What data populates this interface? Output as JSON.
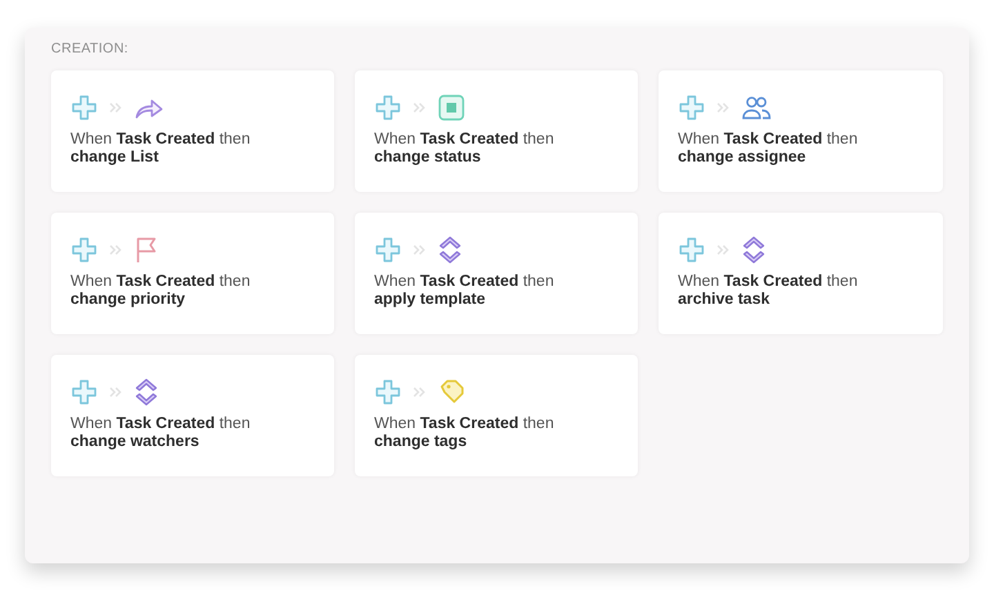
{
  "section_title": "CREATION:",
  "recipes": [
    {
      "kind": "share",
      "trigger": "When **Task Created** then",
      "action": "change List"
    },
    {
      "kind": "status",
      "trigger": "When **Task Created** then",
      "action": "change status"
    },
    {
      "kind": "people",
      "trigger": "When **Task Created** then",
      "action": "change assignee"
    },
    {
      "kind": "flag",
      "trigger": "When **Task Created** then",
      "action": "change priority"
    },
    {
      "kind": "chevrons",
      "trigger": "When **Task Created** then",
      "action": "apply template"
    },
    {
      "kind": "chevrons",
      "trigger": "When **Task Created** then",
      "action": "archive task"
    },
    {
      "kind": "chevrons",
      "trigger": "When **Task Created** then",
      "action": "change watchers"
    },
    {
      "kind": "tag",
      "trigger": "When **Task Created** then",
      "action": "change tags"
    }
  ]
}
